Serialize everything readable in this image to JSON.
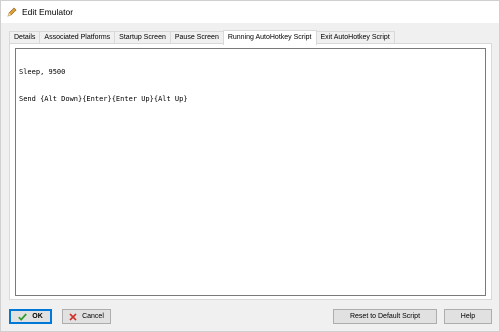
{
  "window": {
    "title": "Edit Emulator",
    "icon": "pencil-icon"
  },
  "tabs": [
    {
      "label": "Details",
      "active": false
    },
    {
      "label": "Associated Platforms",
      "active": false
    },
    {
      "label": "Startup Screen",
      "active": false
    },
    {
      "label": "Pause Screen",
      "active": false
    },
    {
      "label": "Running AutoHotkey Script",
      "active": true
    },
    {
      "label": "Exit AutoHotkey Script",
      "active": false
    }
  ],
  "editor": {
    "lines": [
      "Sleep, 9500",
      "Send {Alt Down}{Enter}{Enter Up}{Alt Up}"
    ]
  },
  "buttons": {
    "ok": {
      "label": "OK",
      "icon": "checkmark-icon",
      "color": "#2e9e2e"
    },
    "cancel": {
      "label": "Cancel",
      "icon": "cross-icon",
      "color": "#d0312d"
    },
    "reset": {
      "label": "Reset to Default Script"
    },
    "help": {
      "label": "Help"
    }
  }
}
